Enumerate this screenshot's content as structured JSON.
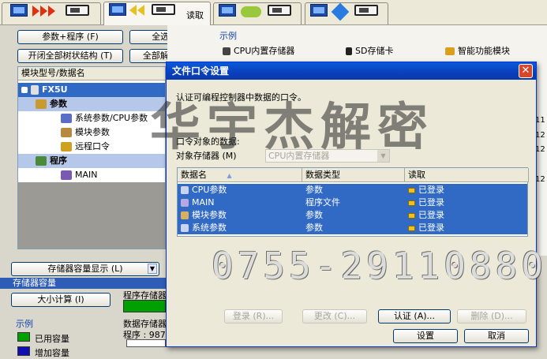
{
  "tabs": [
    {
      "label": ""
    },
    {
      "label": "读取"
    },
    {
      "label": ""
    },
    {
      "label": ""
    }
  ],
  "left": {
    "btn_param_program": "参数+程序 (F)",
    "btn_select_all": "全选 (A)",
    "btn_expand_tree": "开闭全部树状结构 (T)",
    "btn_deselect_all": "全部解除 (N)",
    "tree_header": "模块型号/数据名",
    "tree": [
      {
        "label": "FX5U"
      },
      {
        "label": "参数"
      },
      {
        "label": "系统参数/CPU参数"
      },
      {
        "label": "模块参数"
      },
      {
        "label": "远程口令"
      },
      {
        "label": "程序"
      },
      {
        "label": "MAIN"
      }
    ],
    "memory_display_btn": "存储器容量显示 (L)",
    "memory_section": "存储器容量",
    "size_calc_btn": "大小计算 (I)",
    "legend_title": "示例",
    "legend": [
      {
        "label": "已用容量",
        "color": "#00a000"
      },
      {
        "label": "增加容量",
        "color": "#1010b0"
      }
    ],
    "program_memory_label": "程序存储器",
    "data_memory_label": "数据存储器",
    "program_value": "程序 : 987"
  },
  "example": {
    "title": "示例",
    "items": [
      "CPU内置存储器",
      "SD存储卡",
      "智能功能模块"
    ]
  },
  "right_fragments": [
    "11",
    "12",
    "12",
    "12"
  ],
  "dialog": {
    "title": "文件口令设置",
    "close": "✕",
    "description": "认证可编程控制器中数据的口令。",
    "target_label": "口令对象的数据:",
    "memory_label": "对象存储器 (M)",
    "memory_value": "CPU内置存储器",
    "columns": [
      "数据名",
      "数据类型",
      "读取"
    ],
    "rows": [
      {
        "name": "CPU参数",
        "type": "参数",
        "read": "已登录"
      },
      {
        "name": "MAIN",
        "type": "程序文件",
        "read": "已登录"
      },
      {
        "name": "模块参数",
        "type": "参数",
        "read": "已登录"
      },
      {
        "name": "系统参数",
        "type": "参数",
        "read": "已登录"
      }
    ],
    "btn_register": "登录 (R)...",
    "btn_change": "更改 (C)...",
    "btn_authenticate": "认证 (A)...",
    "btn_delete": "删除 (D)...",
    "btn_settings": "设置",
    "btn_cancel": "取消"
  },
  "watermark": {
    "text": "华宇杰解密",
    "phone": "0755-29110880"
  }
}
